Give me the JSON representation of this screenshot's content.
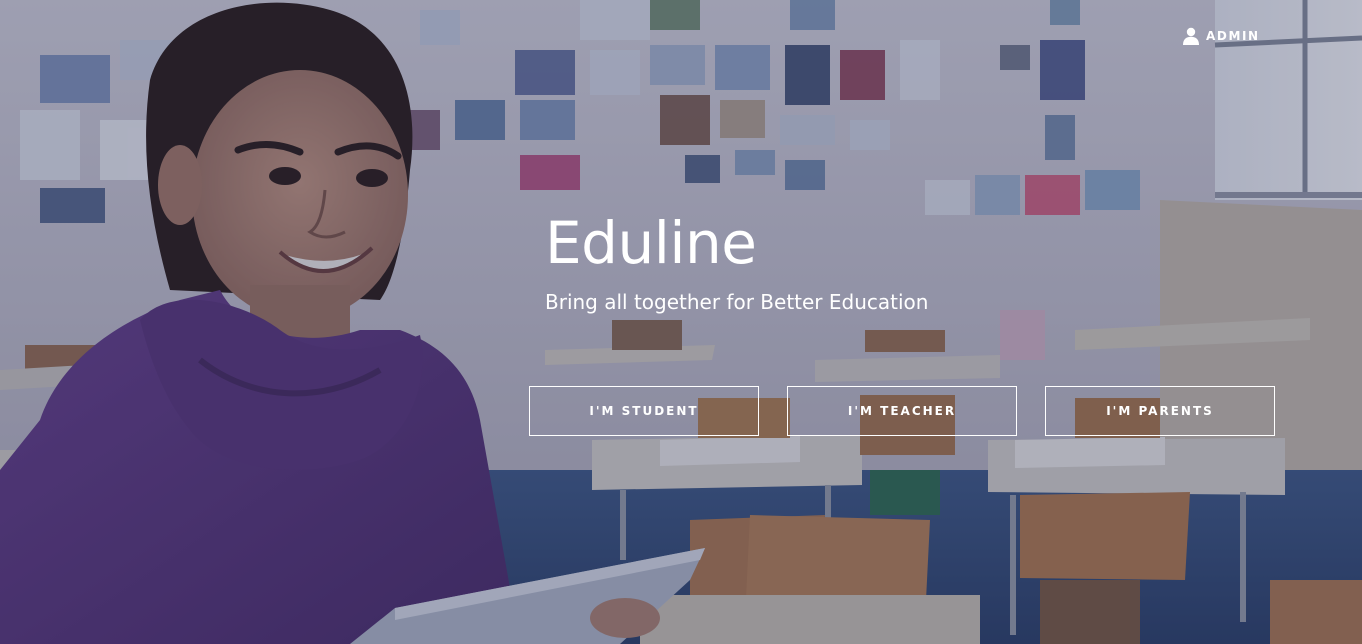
{
  "header": {
    "admin_label": "ADMIN",
    "admin_icon": "user-icon"
  },
  "hero": {
    "title": "Eduline",
    "tagline": "Bring all together for Better Education",
    "buttons": [
      {
        "label": "I'M STUDENT"
      },
      {
        "label": "I'M TEACHER"
      },
      {
        "label": "I'M PARENTS"
      }
    ]
  },
  "colors": {
    "text": "#ffffff",
    "button_border": "#ffffff",
    "overlay": "#2a2f55"
  }
}
